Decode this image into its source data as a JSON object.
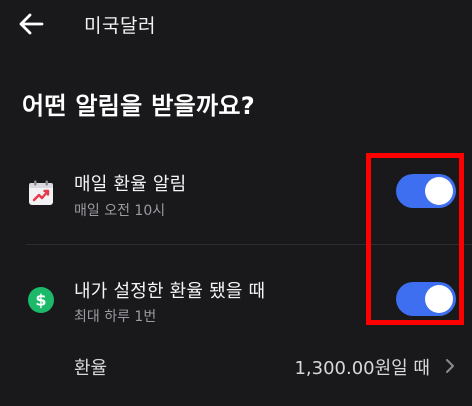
{
  "header": {
    "title": "미국달러"
  },
  "question": "어떤 알림을 받을까요?",
  "alerts": [
    {
      "title": "매일 환율 알림",
      "subtitle": "매일 오전 10시",
      "icon": "calendar-trend-icon",
      "enabled": true
    },
    {
      "title": "내가 설정한 환율 됐을 때",
      "subtitle": "최대 하루 1번",
      "icon": "dollar-coin-icon",
      "enabled": true
    }
  ],
  "rate": {
    "label": "환율",
    "value": "1,300.00원일 때"
  },
  "colors": {
    "background": "#19191c",
    "toggle_on": "#3e6ff0",
    "coin": "#1db96a",
    "highlight": "#ff0000"
  }
}
